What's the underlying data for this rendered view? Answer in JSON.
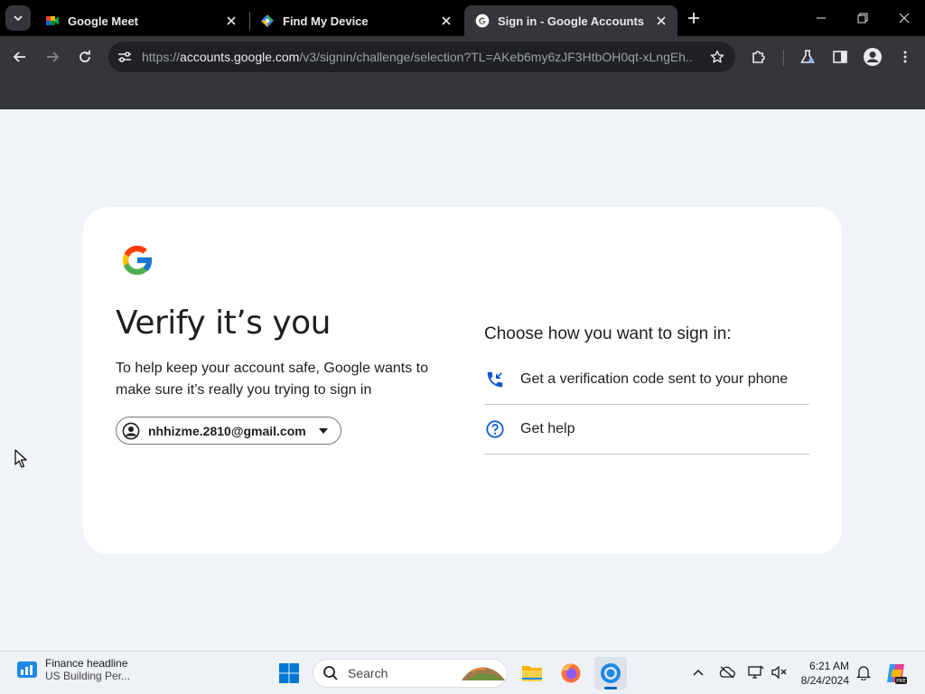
{
  "browser": {
    "tabs": [
      {
        "title": "Google Meet",
        "favicon": "google-meet-icon",
        "active": false
      },
      {
        "title": "Find My Device",
        "favicon": "find-my-device-icon",
        "active": false
      },
      {
        "title": "Sign in - Google Accounts",
        "favicon": "google-g-icon",
        "active": true
      }
    ],
    "url_prefix": "https://",
    "url_host": "accounts.google.com",
    "url_path": "/v3/signin/challenge/selection?TL=AKeb6my6zJF3HtbOH0qt-xLngEh...",
    "icons": [
      "back-icon",
      "forward-icon",
      "reload-icon",
      "site-info-icon",
      "bookmark-star-icon",
      "extensions-icon",
      "labs-icon",
      "side-panel-icon",
      "profile-icon",
      "menu-icon"
    ]
  },
  "signin": {
    "heading": "Verify it’s you",
    "description": "To help keep your account safe, Google wants to make sure it’s really you trying to sign in",
    "account_email": "nhhizme.2810@gmail.com",
    "choose_title": "Choose how you want to sign in:",
    "options": [
      {
        "label": "Get a verification code sent to your phone",
        "icon": "phone-callback-icon"
      },
      {
        "label": "Get help",
        "icon": "help-icon"
      }
    ],
    "accent_color": "#0b57d0"
  },
  "taskbar": {
    "widget_title": "Finance headline",
    "widget_subtitle": "US Building Per...",
    "search_placeholder": "Search",
    "time": "6:21 AM",
    "date": "8/24/2024"
  }
}
